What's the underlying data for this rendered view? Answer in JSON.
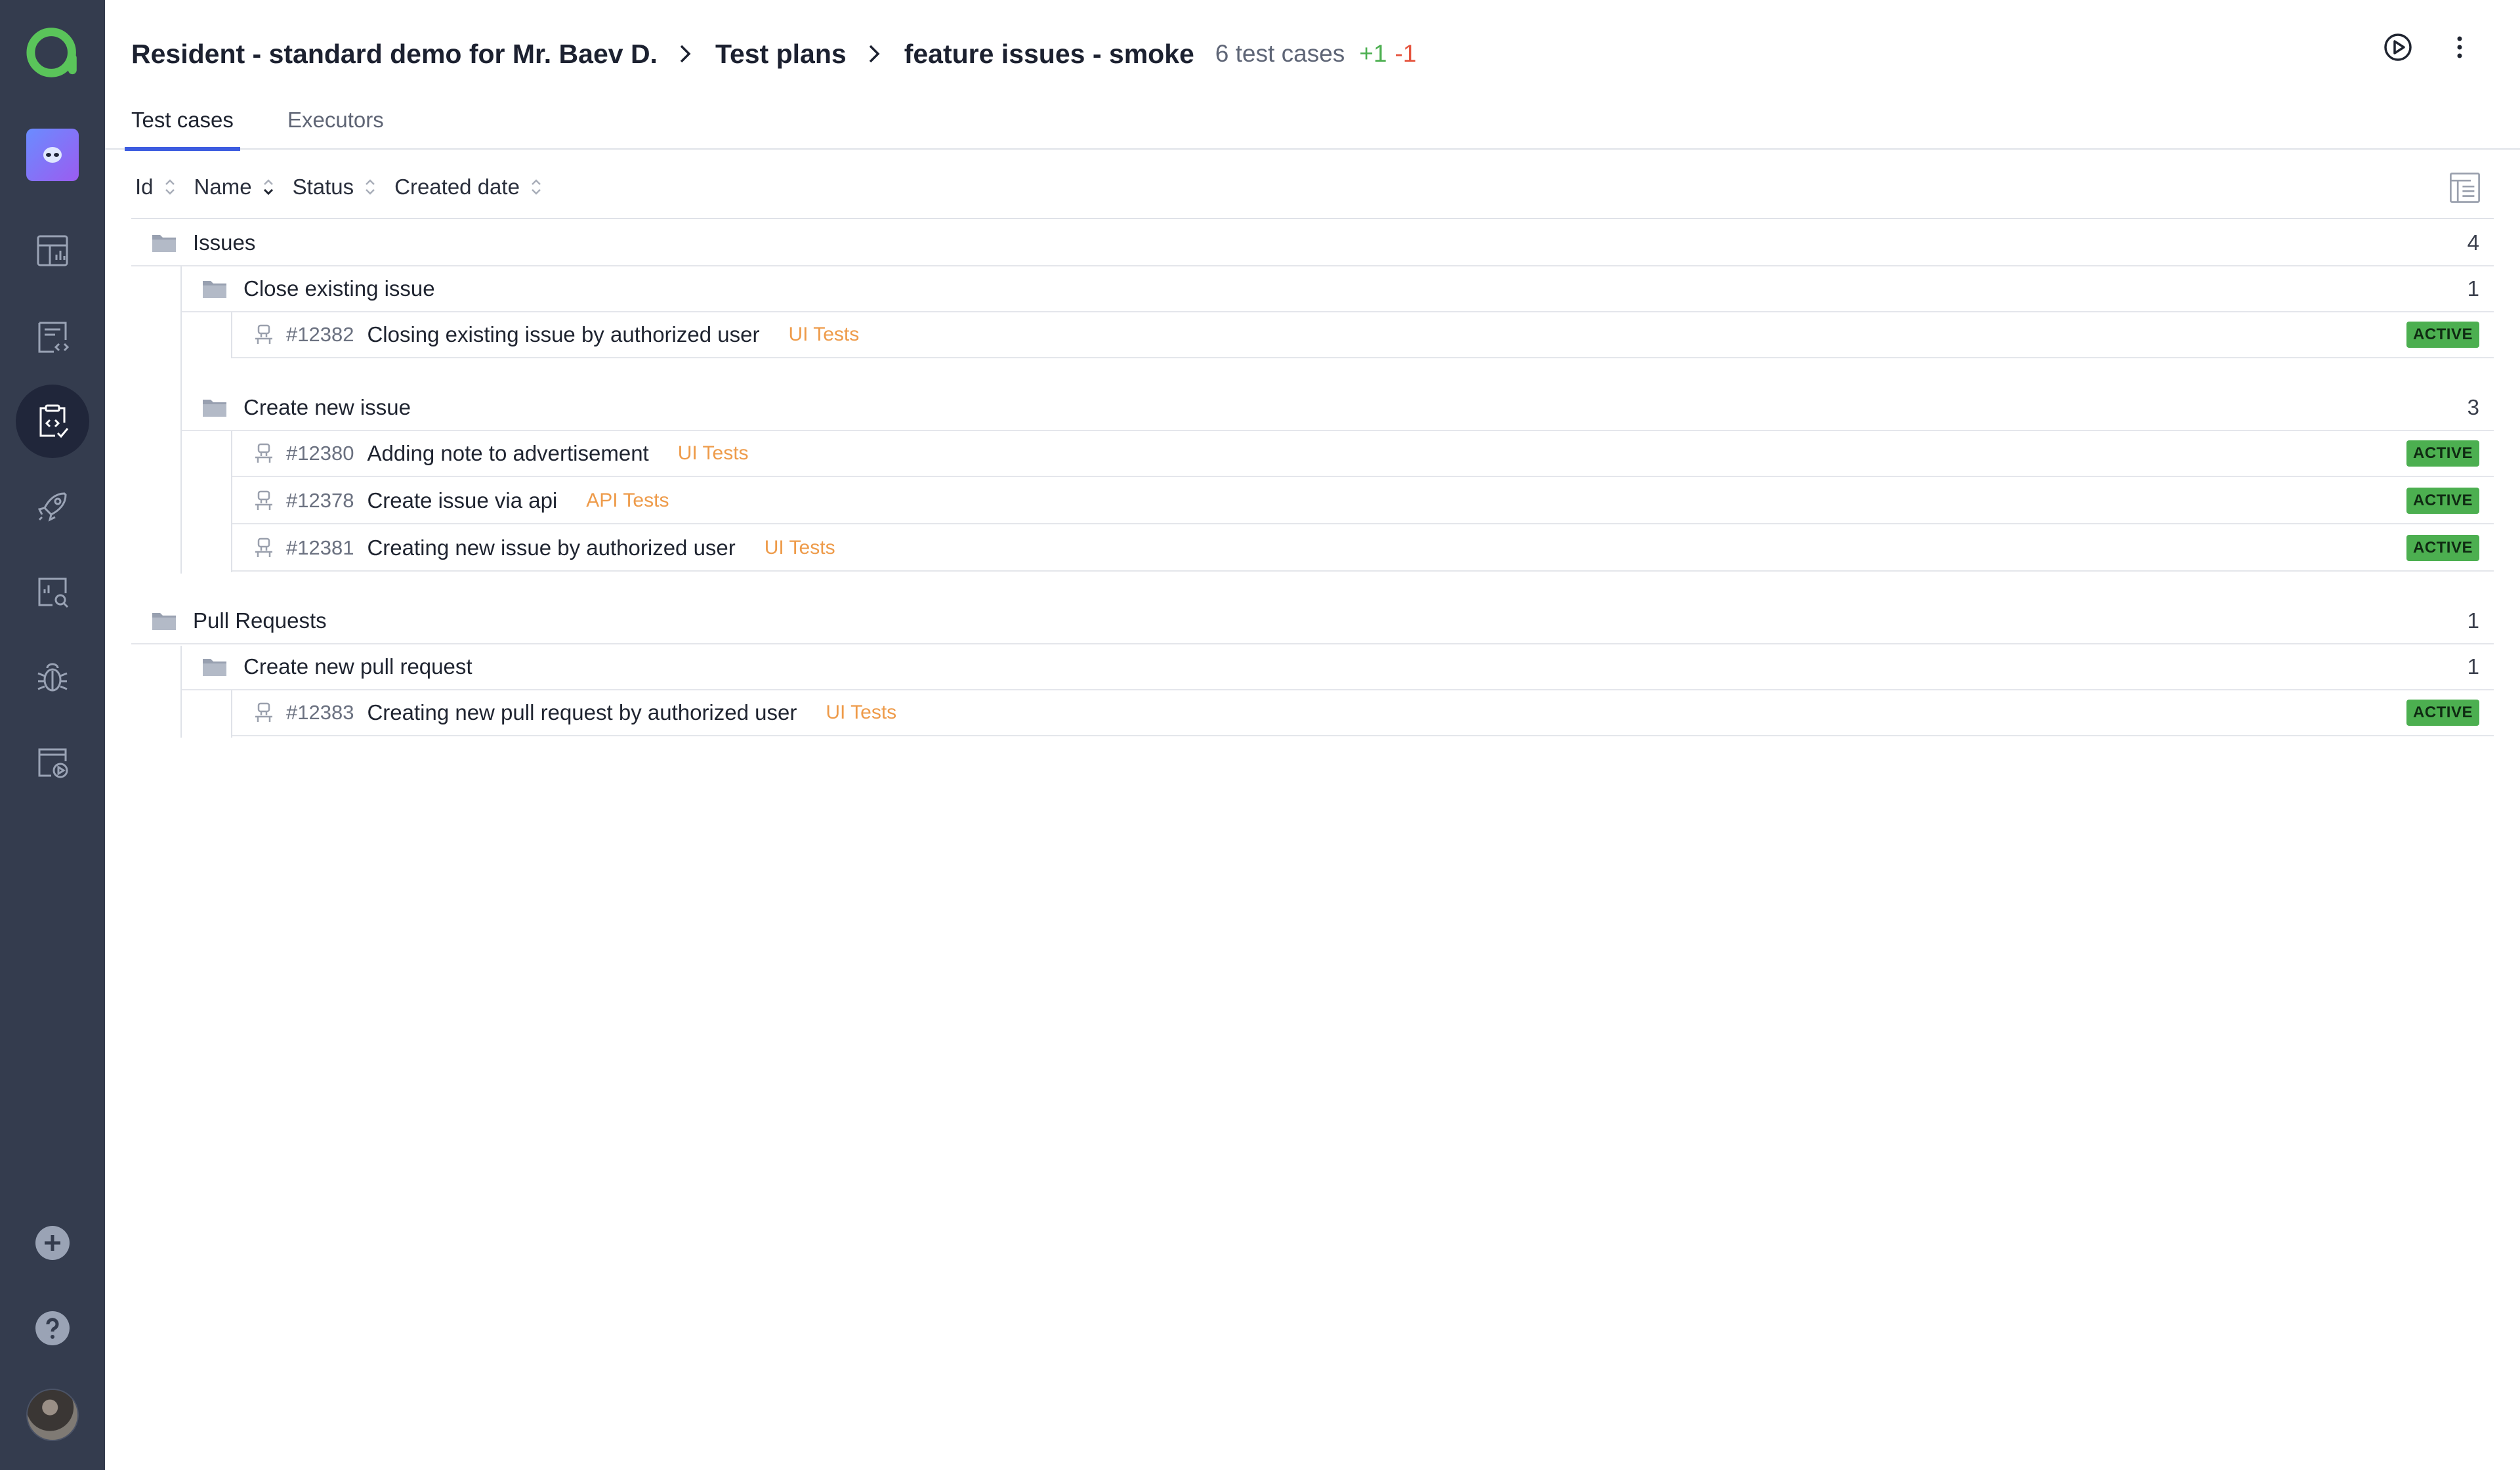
{
  "app": {
    "brand_color": "#5ac45a",
    "sidebar_color": "#343c4e"
  },
  "sidebar": {
    "items": [
      {
        "icon": "dashboard-icon"
      },
      {
        "icon": "code-file-icon"
      },
      {
        "icon": "test-plan-clipboard-icon",
        "active": true
      },
      {
        "icon": "rocket-icon"
      },
      {
        "icon": "report-search-icon"
      },
      {
        "icon": "bug-icon"
      },
      {
        "icon": "job-run-icon"
      }
    ],
    "bottom": [
      {
        "icon": "add-icon"
      },
      {
        "icon": "help-icon"
      }
    ]
  },
  "header": {
    "crumbs": [
      "Resident - standard demo for Mr. Baev D.",
      "Test plans",
      "feature issues - smoke"
    ],
    "meta": "6 test cases",
    "added": "+1",
    "removed": "-1"
  },
  "tabs": [
    "Test cases",
    "Executors"
  ],
  "columns": [
    "Id",
    "Name",
    "Status",
    "Created date"
  ],
  "tree": {
    "groups": [
      {
        "name": "Issues",
        "count": "4",
        "subgroups": [
          {
            "name": "Close existing issue",
            "count": "1",
            "cases": [
              {
                "id": "#12382",
                "name": "Closing existing issue by authorized user",
                "tag": "UI Tests",
                "status": "ACTIVE"
              }
            ]
          },
          {
            "name": "Create new issue",
            "count": "3",
            "cases": [
              {
                "id": "#12380",
                "name": "Adding note to advertisement",
                "tag": "UI Tests",
                "status": "ACTIVE"
              },
              {
                "id": "#12378",
                "name": "Create issue via api",
                "tag": "API Tests",
                "status": "ACTIVE"
              },
              {
                "id": "#12381",
                "name": "Creating new issue by authorized user",
                "tag": "UI Tests",
                "status": "ACTIVE"
              }
            ]
          }
        ]
      },
      {
        "name": "Pull Requests",
        "count": "1",
        "subgroups": [
          {
            "name": "Create new pull request",
            "count": "1",
            "cases": [
              {
                "id": "#12383",
                "name": "Creating new pull request by authorized user",
                "tag": "UI Tests",
                "status": "ACTIVE"
              }
            ]
          }
        ]
      }
    ]
  }
}
